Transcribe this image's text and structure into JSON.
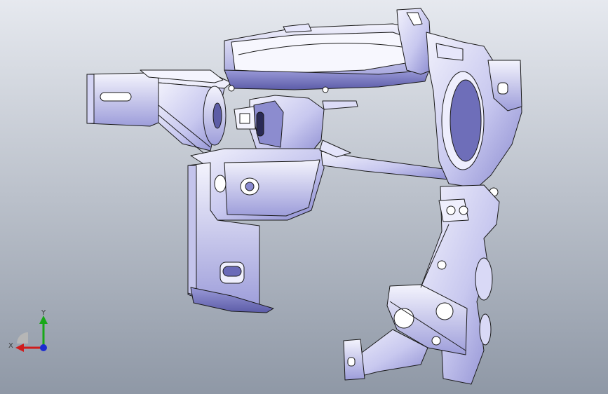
{
  "viewport": {
    "background_top": "#e6e9ef",
    "background_bottom": "#8f98a6"
  },
  "model": {
    "fill_light": "#e9e9f8",
    "fill_mid": "#b9b9e6",
    "fill_dark": "#7e7ec4",
    "edge": "#1a1a1a"
  },
  "triad": {
    "x_label": "X",
    "y_label": "Y",
    "x_color": "#d01c1c",
    "y_color": "#18a818",
    "z_color": "#1c2cd0",
    "origin_color": "#b6b6b6"
  }
}
